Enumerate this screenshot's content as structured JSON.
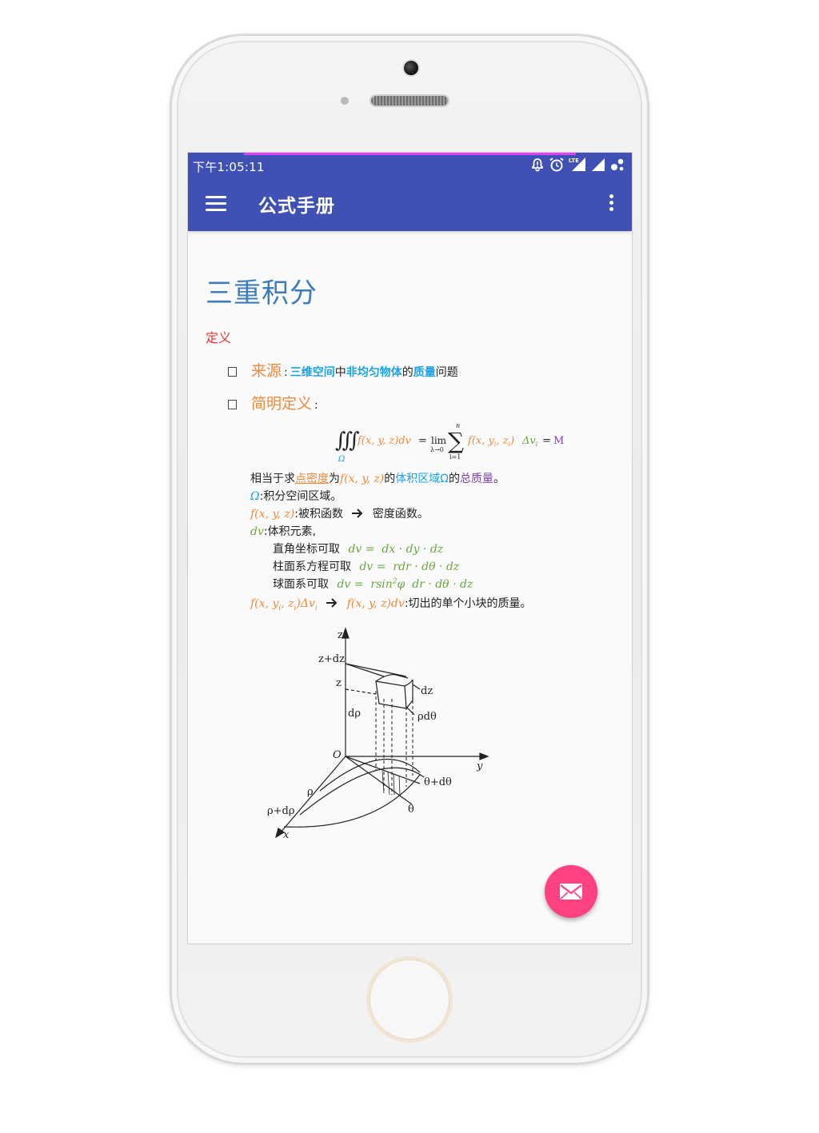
{
  "status": {
    "time": "下午1:05:11",
    "lte": "LTE"
  },
  "appbar": {
    "title": "公式手册"
  },
  "page": {
    "title": "三重积分",
    "definition_label": "定义",
    "source": {
      "label": "来源",
      "sep": ":",
      "part1": "三维空间",
      "part2": "中",
      "part3": "非均匀物体",
      "part4": "的",
      "part5": "质量",
      "part6": "问题"
    },
    "brief": {
      "label": "简明定义",
      "sep": ":"
    },
    "formula": {
      "lhs": "f(x, y, z)dv",
      "eq": "=",
      "lim": "lim",
      "lim_sub": "λ→0",
      "sum_top": "n",
      "sum_bottom": "i=1",
      "term": "f(x, y",
      "term2": ", z",
      "term3": ")",
      "delta": "Δv",
      "eq2": "=",
      "result": "M",
      "omega": "Ω"
    },
    "explain": {
      "l1_a": "相当于求",
      "l1_b": "点密度",
      "l1_c": "为",
      "l1_d": "f(x, y, z)",
      "l1_e": "的",
      "l1_f": "体积区域Ω",
      "l1_g": "的",
      "l1_h": "总质量",
      "l1_i": "。",
      "l2_a": "Ω",
      "l2_b": ":积分空间区域。",
      "l3_a": "f(x, y, z)",
      "l3_b": ":被积函数",
      "l3_c": "密度函数。",
      "l4_a": "dv",
      "l4_b": ":体积元素,",
      "l5_a": "直角坐标可取",
      "l5_b": "dv =  dx · dy · dz",
      "l6_a": "柱面系方程可取",
      "l6_b": "dv =  rdr · dθ · dz",
      "l7_a": "球面系可取",
      "l7_b": "dv =  rsin",
      "l7_sup": "2",
      "l7_c": "φ  dr · dθ · dz",
      "l8_a": "f(x, y",
      "l8_b": ", z",
      "l8_c": ")Δv",
      "l8_d": "f(x, y, z)dv",
      "l8_e": ":切出的单个小块的质量。",
      "sub_i": "i"
    },
    "diagram": {
      "z": "z",
      "z_dz": "z+dz",
      "z2": "z",
      "dz": "dz",
      "drho": "dρ",
      "rhodtheta": "ρdθ",
      "origin": "O",
      "y": "y",
      "theta_dtheta": "θ+dθ",
      "theta": "θ",
      "rho": "ρ",
      "rho_drho": "ρ+dρ",
      "x": "x"
    }
  },
  "colors": {
    "primary": "#3f51b5",
    "accent": "#ff4081",
    "title": "#3d7dbd",
    "orange": "#ef8a3c",
    "blue": "#1aa3e8",
    "green": "#6ba53f",
    "purple": "#7e3fb0",
    "red": "#e53935"
  },
  "icons": {
    "menu": "menu-icon",
    "overflow": "overflow-menu-icon",
    "fab": "mail-icon",
    "alarm": "alarm-icon",
    "notification": "notification-icon",
    "signal": "signal-icon",
    "battery": "battery-icon"
  }
}
